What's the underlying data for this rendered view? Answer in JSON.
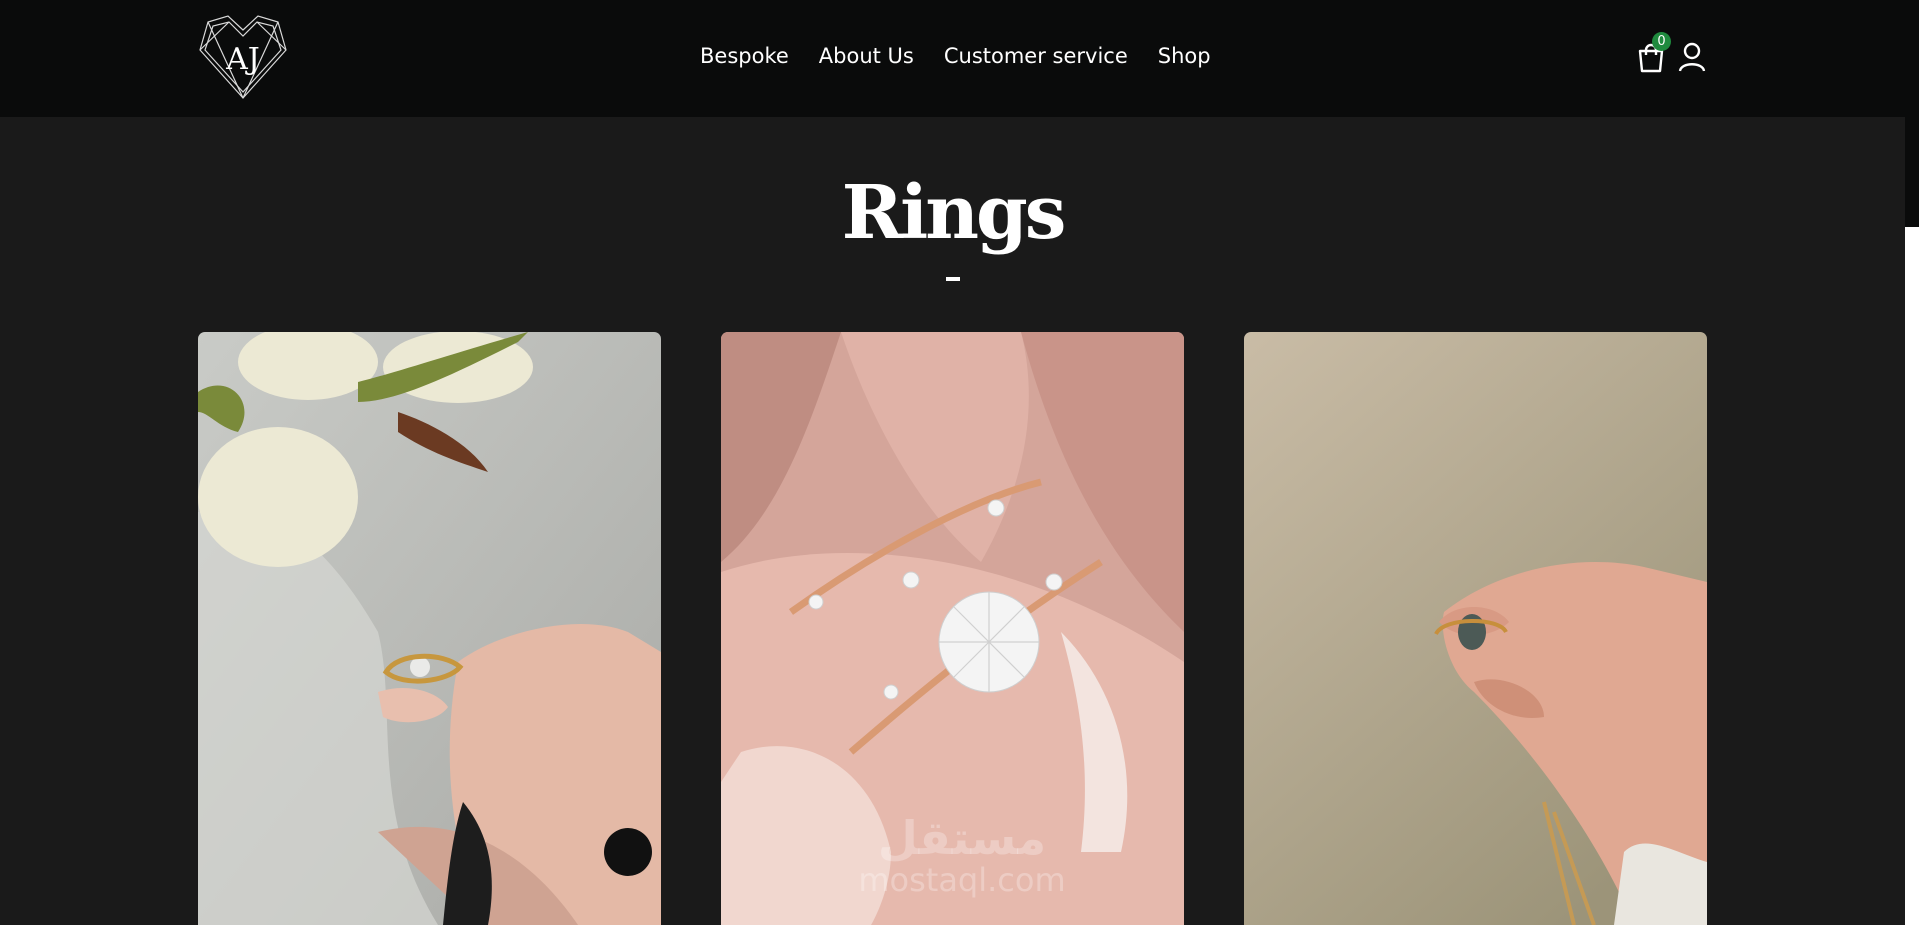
{
  "header": {
    "nav": [
      {
        "label": "Bespoke"
      },
      {
        "label": "About Us"
      },
      {
        "label": "Customer service"
      },
      {
        "label": "Shop"
      }
    ],
    "cart_count": "0",
    "logo_text": "AJ"
  },
  "main": {
    "title": "Rings",
    "products": [
      {
        "image": "ring-held-near-tulips"
      },
      {
        "image": "rose-gold-branch-diamond-ring-set"
      },
      {
        "image": "dark-gem-ring-held"
      }
    ]
  },
  "watermark": {
    "arabic": "مستقل",
    "latin": "mostaql.com"
  },
  "colors": {
    "topbar": "#0a0b0b",
    "page_background": "#1a1a1a",
    "badge": "#1f8a3e"
  },
  "icons": [
    "logo-heart-icon",
    "cart-icon",
    "user-icon"
  ]
}
